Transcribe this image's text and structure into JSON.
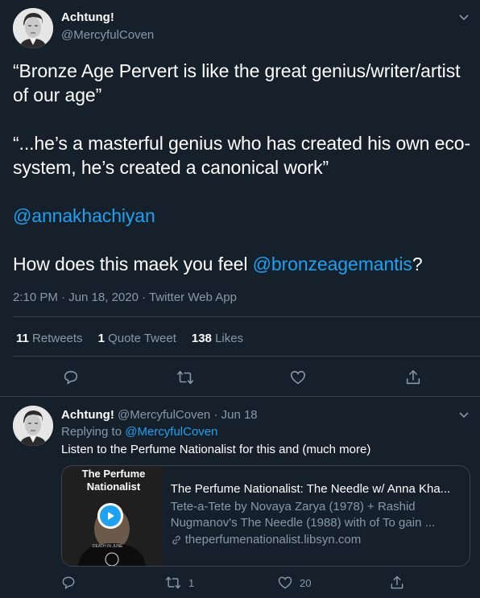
{
  "main_tweet": {
    "name": "Achtung!",
    "handle": "@MercyfulCoven",
    "p1": "“Bronze Age Pervert is like the great genius/writer/artist of our age”",
    "p2": "“...he’s a masterful genius who has created his own eco-system, he’s created a canonical work”",
    "p3_mention": "@annakhachiyan",
    "p4_text": "How does this maek you feel ",
    "p4_mention": "@bronzeagemantis",
    "p4_end": "?",
    "meta": "2:10 PM · Jun 18, 2020 · Twitter Web App",
    "stats": {
      "retweets_count": "11",
      "retweets_label": "Retweets",
      "quotes_count": "1",
      "quotes_label": "Quote Tweet",
      "likes_count": "138",
      "likes_label": "Likes"
    }
  },
  "reply": {
    "name": "Achtung!",
    "handle": "@MercyfulCoven",
    "sep": "·",
    "date": "Jun 18",
    "replying_to_label": "Replying to",
    "replying_to": "@MercyfulCoven",
    "text": "Listen to the Perfume Nationalist for this and (much more)",
    "card": {
      "thumb_title": "The Perfume Nationalist",
      "thumb_shirt": "DEATH IN JUNE",
      "title": "The Perfume Nationalist: The Needle w/ Anna Kha...",
      "desc": "Tete-a-Tete by Novaya Zarya (1978) + Rashid Nugmanov's The Needle (1988) with of To gain ...",
      "link": "theperfumenationalist.libsyn.com"
    },
    "retweets": "1",
    "likes": "20"
  },
  "colors": {
    "background": "#15202b",
    "text": "#ffffff",
    "secondary": "#8899a6",
    "accent": "#1da1f2",
    "divider": "#38444d"
  },
  "icons": [
    "chevron-down-icon",
    "reply-icon",
    "retweet-icon",
    "like-icon",
    "share-icon",
    "play-icon",
    "link-icon"
  ]
}
